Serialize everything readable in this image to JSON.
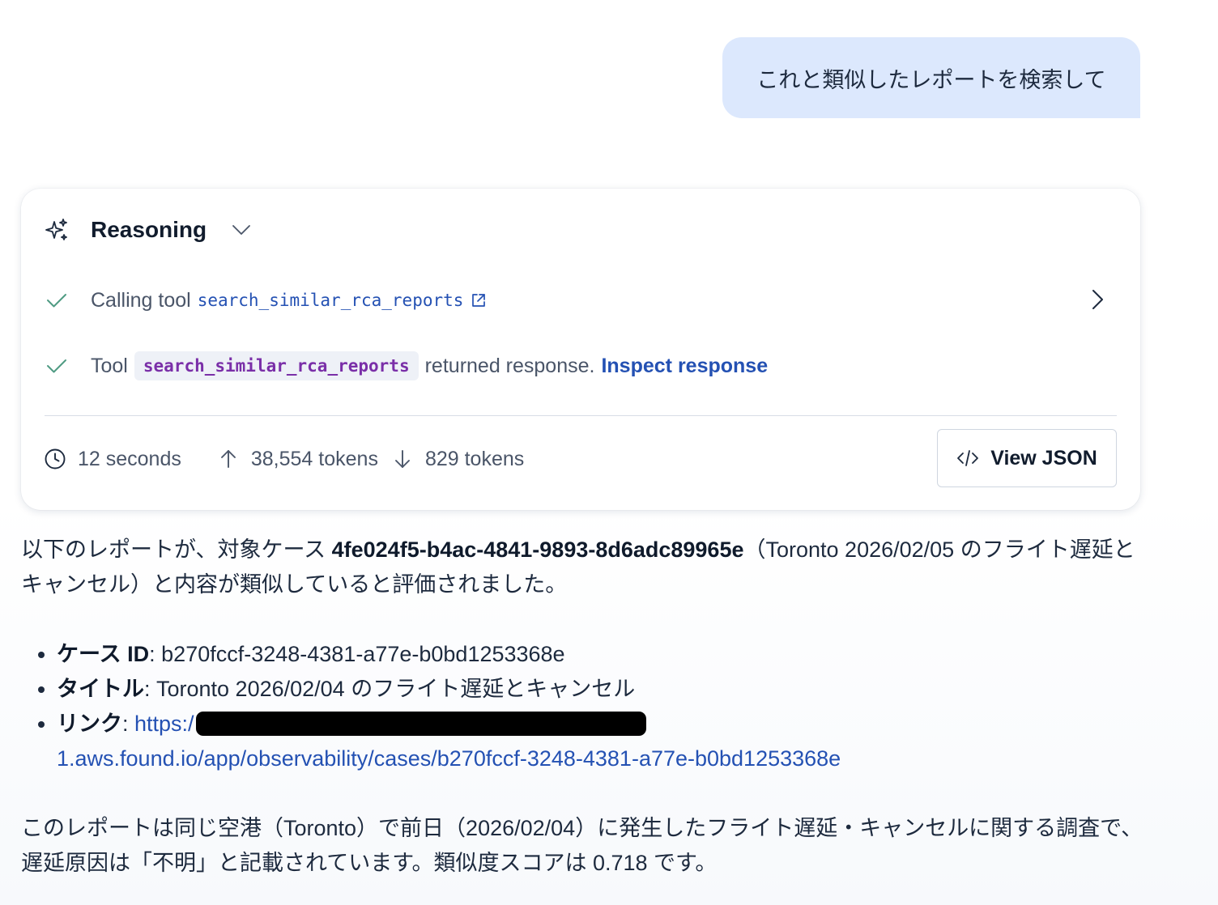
{
  "user_message": "これと類似したレポートを検索して",
  "reasoning": {
    "title": "Reasoning",
    "steps": [
      {
        "prefix": "Calling tool",
        "tool": "search_similar_rca_reports"
      },
      {
        "prefix": "Tool",
        "tool": "search_similar_rca_reports",
        "suffix": "returned response.",
        "link": "Inspect response"
      }
    ],
    "duration": "12 seconds",
    "input_tokens": "38,554 tokens",
    "output_tokens": "829 tokens",
    "view_json_label": "View JSON"
  },
  "answer": {
    "intro_1": "以下のレポートが、対象ケース ",
    "case_ref": "4fe024f5-b4ac-4841-9893-8d6adc89965e",
    "intro_2": "（Toronto 2026/02/05 のフライト遅延とキャンセル）と内容が類似していると評価されました。",
    "items": [
      {
        "label": "ケース ID",
        "value": ": b270fccf-3248-4381-a77e-b0bd1253368e"
      },
      {
        "label": "タイトル",
        "value": ": Toronto 2026/02/04 のフライト遅延とキャンセル"
      },
      {
        "label": "リンク",
        "link_start": "https:/",
        "link_end": "1.aws.found.io/app/observability/cases/b270fccf-3248-4381-a77e-b0bd1253368e"
      }
    ],
    "conclusion": "このレポートは同じ空港（Toronto）で前日（2026/02/04）に発生したフライト遅延・キャンセルに関する調査で、遅延原因は「不明」と記載されています。類似度スコアは 0.718 です。"
  },
  "colors": {
    "user_bubble": "#dce8fd",
    "link": "#2451b3",
    "chip_text": "#7a2fa8",
    "check": "#4f9b83"
  }
}
